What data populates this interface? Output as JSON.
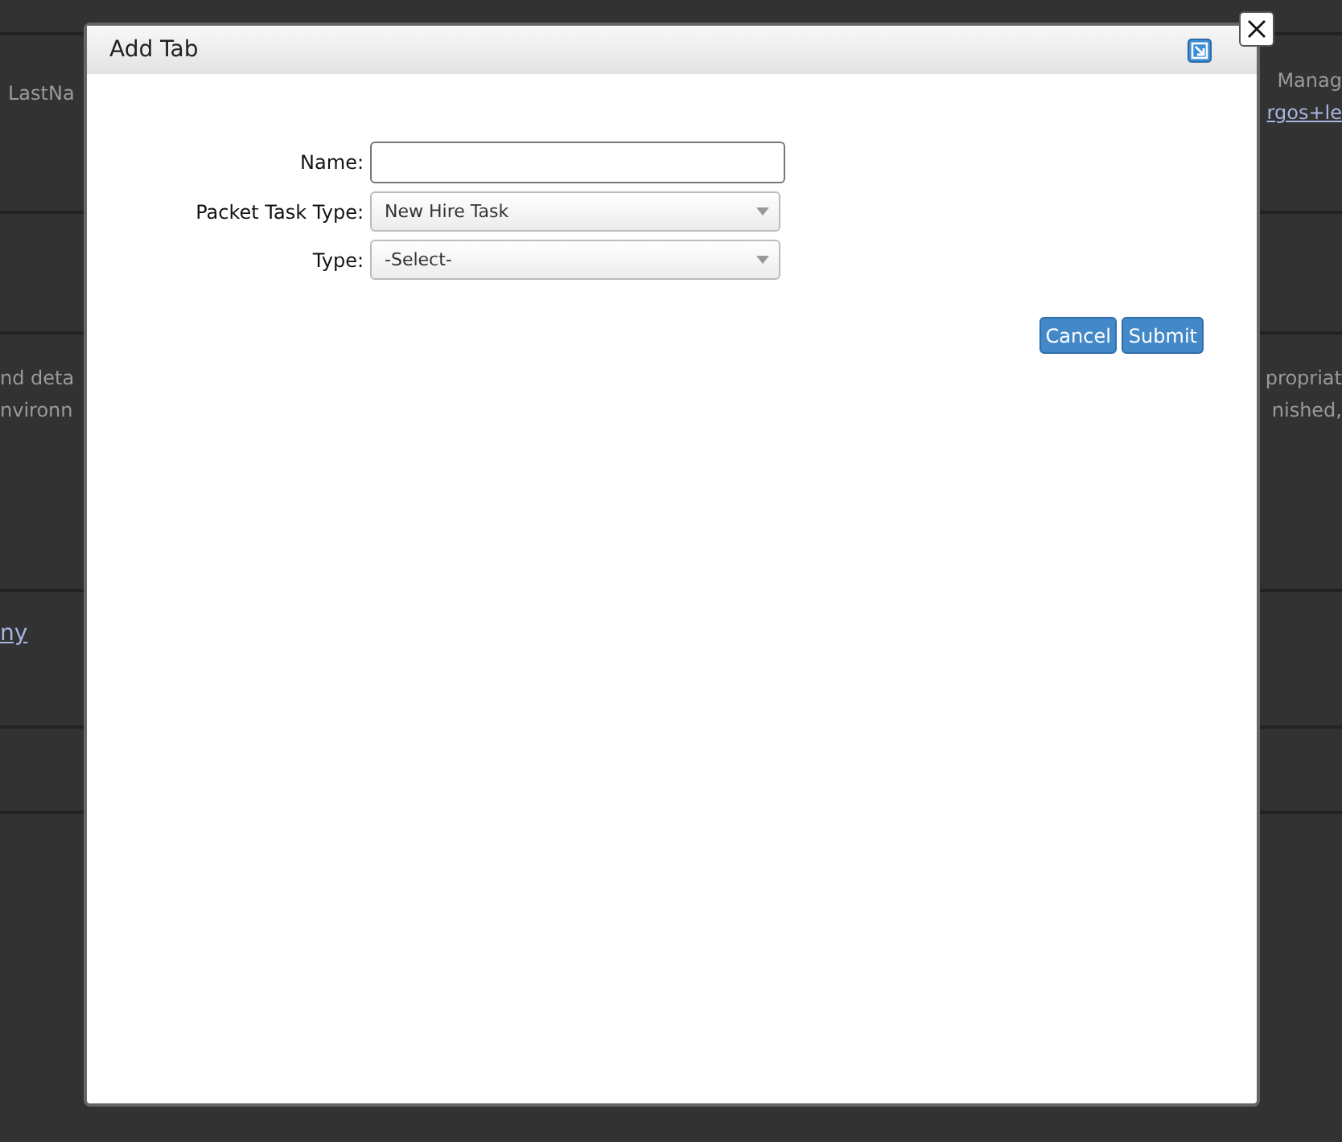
{
  "background_page": {
    "header_left": "LastNa",
    "header_right": "Manag",
    "header_link": "rgos+le",
    "description_left": [
      "nd deta",
      "nvironn"
    ],
    "description_right": [
      "propriat",
      "nished,"
    ],
    "link_left": "ny"
  },
  "dialog": {
    "title": "Add Tab",
    "fields": [
      {
        "kind": "text",
        "label": "Name:"
      },
      {
        "kind": "select",
        "label": "Packet Task Type:",
        "value": "New Hire Task"
      },
      {
        "kind": "select",
        "label": "Type:",
        "value": "-Select-"
      }
    ],
    "buttons": [
      "Cancel",
      "Submit"
    ]
  }
}
